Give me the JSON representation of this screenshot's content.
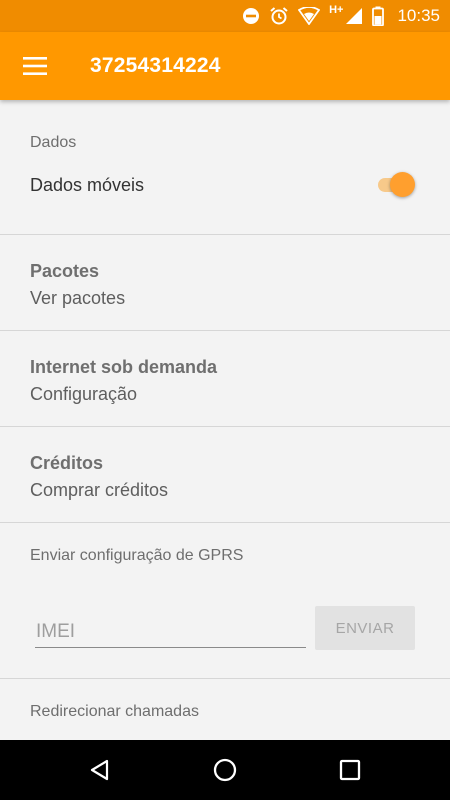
{
  "status_bar": {
    "time": "10:35",
    "network_type": "H+",
    "icons": [
      "do-not-disturb-icon",
      "alarm-icon",
      "wifi-icon",
      "signal-icon",
      "battery-icon"
    ]
  },
  "app_bar": {
    "title": "37254314224",
    "menu_icon": "menu-icon"
  },
  "data_section": {
    "category": "Dados",
    "mobile_data_label": "Dados móveis",
    "mobile_data_enabled": true
  },
  "items": [
    {
      "title": "Pacotes",
      "subtitle": "Ver pacotes"
    },
    {
      "title": "Internet sob demanda",
      "subtitle": "Configuração"
    },
    {
      "title": "Créditos",
      "subtitle": "Comprar créditos"
    }
  ],
  "gprs_section": {
    "category": "Enviar configuração de GPRS",
    "imei_placeholder": "IMEI",
    "imei_value": "",
    "send_label": "ENVIAR"
  },
  "redirect_section": {
    "category": "Redirecionar chamadas"
  },
  "nav_bar": {
    "icons": [
      "back-icon",
      "home-icon",
      "recents-icon"
    ]
  },
  "colors": {
    "status_bar": "#f08c00",
    "app_bar": "#ff9800",
    "accent": "#ff9f2e",
    "background": "#f3f3f3"
  }
}
